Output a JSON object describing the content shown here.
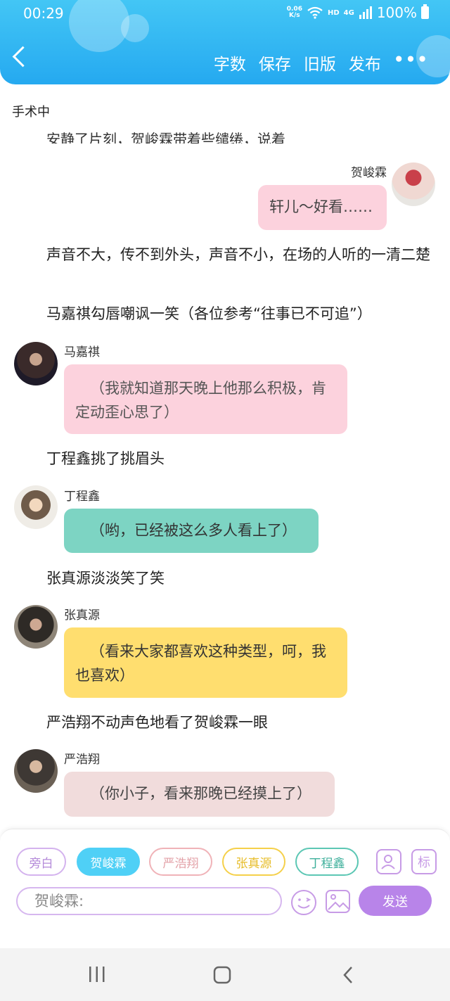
{
  "status": {
    "time": "00:29",
    "net_speed_value": "0.06",
    "net_speed_unit": "K/s",
    "hd": "HD",
    "network": "4G",
    "battery": "100%"
  },
  "toolbar": {
    "word_count": "字数",
    "save": "保存",
    "old_version": "旧版",
    "publish": "发布"
  },
  "page": {
    "title": "手术中",
    "cut_text": "安静了片刻，贺峻霖带着些缱绻，说着"
  },
  "messages": [
    {
      "speaker": "贺峻霖",
      "text": "轩儿～好看……"
    },
    {
      "narration": "声音不大，传不到外头，声音不小，在场的人听的一清二楚"
    },
    {
      "narration": "马嘉祺勾唇嘲讽一笑（各位参考“往事已不可追”）"
    },
    {
      "speaker": "马嘉祺",
      "text": "（我就知道那天晚上他那么积极，肯定动歪心思了）"
    },
    {
      "narration": "丁程鑫挑了挑眉头"
    },
    {
      "speaker": "丁程鑫",
      "text": "（哟，已经被这么多人看上了）"
    },
    {
      "narration": "张真源淡淡笑了笑"
    },
    {
      "speaker": "张真源",
      "text": "（看来大家都喜欢这种类型，呵，我也喜欢）"
    },
    {
      "narration": "严浩翔不动声色地看了贺峻霖一眼"
    },
    {
      "speaker": "严浩翔",
      "text": "（你小子，看来那晚已经摸上了）"
    }
  ],
  "chips": [
    "旁白",
    "贺峻霖",
    "严浩翔",
    "张真源",
    "丁程鑫"
  ],
  "tools": {
    "biao": "标"
  },
  "input": {
    "placeholder": "贺峻霖:"
  },
  "send_label": "发送",
  "colors": {
    "header": "#25a9f0",
    "chip_active": "#4fd0f6",
    "send": "#b884e9"
  },
  "icons": [
    "back-arrow-icon",
    "more-dots-icon",
    "wifi-icon",
    "signal-icon",
    "battery-icon",
    "character-card-icon",
    "emoji-icon",
    "image-icon",
    "recent-apps-icon",
    "home-icon",
    "nav-back-icon"
  ]
}
